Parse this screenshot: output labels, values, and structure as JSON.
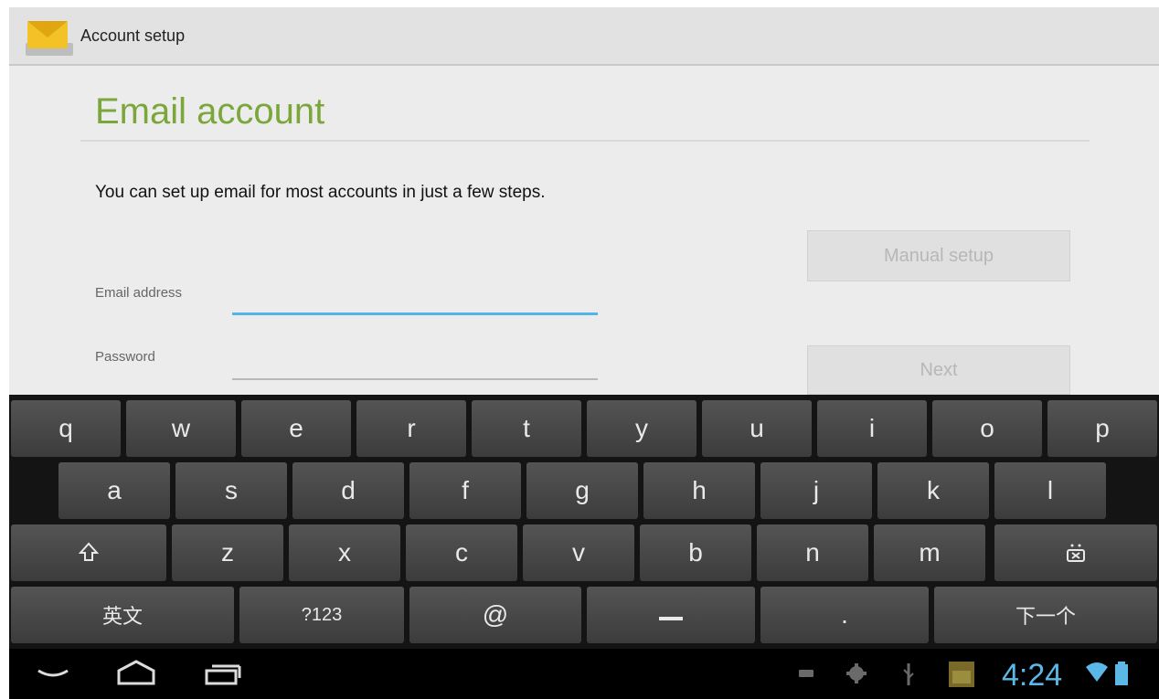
{
  "action_bar": {
    "title": "Account setup",
    "app_icon": "email-envelope-icon"
  },
  "form": {
    "heading": "Email account",
    "intro": "You can set up email for most accounts in just a few steps.",
    "email_label": "Email address",
    "email_value": "",
    "password_label": "Password",
    "password_value": "",
    "manual_setup_label": "Manual setup",
    "next_label": "Next"
  },
  "keyboard": {
    "row1": [
      "q",
      "w",
      "e",
      "r",
      "t",
      "y",
      "u",
      "i",
      "o",
      "p"
    ],
    "row2": [
      "a",
      "s",
      "d",
      "f",
      "g",
      "h",
      "j",
      "k",
      "l"
    ],
    "row3_letters": [
      "z",
      "x",
      "c",
      "v",
      "b",
      "n",
      "m"
    ],
    "shift_icon": "shift-icon",
    "delete_icon": "delete-key-icon",
    "lang_label": "英文",
    "sym_label": "?123",
    "at_label": "@",
    "space_icon": "space-bar-icon",
    "period_label": ".",
    "enter_label": "下一个"
  },
  "nav_bar": {
    "back_icon": "back-icon",
    "home_icon": "home-icon",
    "recents_icon": "recent-apps-icon",
    "status_icons": [
      "keyboard-icon",
      "debug-icon",
      "usb-icon",
      "app-notification-icon",
      "wifi-icon",
      "battery-icon"
    ],
    "time": "4:24"
  }
}
